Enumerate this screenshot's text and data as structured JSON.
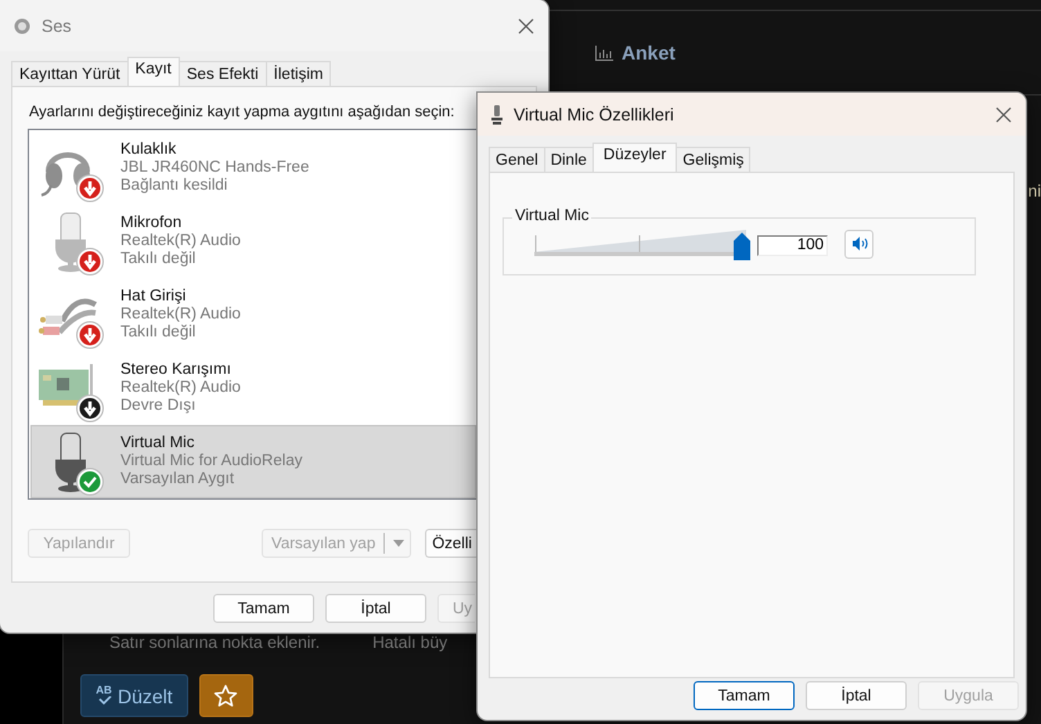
{
  "background_app": {
    "section_title": "Anket",
    "edge_text": "ni",
    "hints": [
      "Satır sonlarına nokta eklenir.",
      "Hatalı büy"
    ],
    "fix_button": {
      "icon_text": "AB",
      "label": "Düzelt"
    }
  },
  "sound_window": {
    "title": "Ses",
    "tabs": [
      {
        "label": "Kayıttan Yürüt",
        "selected": false
      },
      {
        "label": "Kayıt",
        "selected": true
      },
      {
        "label": "Ses Efekti",
        "selected": false
      },
      {
        "label": "İletişim",
        "selected": false
      }
    ],
    "instruction": "Ayarlarını değiştireceğiniz kayıt yapma aygıtını aşağıdan seçin:",
    "devices": [
      {
        "name": "Kulaklık",
        "driver": "JBL JR460NC Hands-Free",
        "status_text": "Bağlantı kesildi",
        "kind": "headset",
        "enabled": true,
        "default": false,
        "selected": false
      },
      {
        "name": "Mikrofon",
        "driver": "Realtek(R) Audio",
        "status_text": "Takılı değil",
        "kind": "microphone",
        "enabled": true,
        "default": false,
        "selected": false
      },
      {
        "name": "Hat Girişi",
        "driver": "Realtek(R) Audio",
        "status_text": "Takılı değil",
        "kind": "cable",
        "enabled": true,
        "default": false,
        "selected": false
      },
      {
        "name": "Stereo Karışımı",
        "driver": "Realtek(R) Audio",
        "status_text": "Devre Dışı",
        "kind": "card",
        "enabled": false,
        "default": false,
        "selected": false
      },
      {
        "name": "Virtual Mic",
        "driver": "Virtual Mic for AudioRelay",
        "status_text": "Varsayılan Aygıt",
        "kind": "microphone",
        "enabled": true,
        "default": true,
        "selected": true
      }
    ],
    "configure_button": {
      "label": "Yapılandır",
      "disabled": true
    },
    "set_default_button": {
      "label": "Varsayılan yap",
      "disabled": true
    },
    "properties_button": {
      "label": "Özelli",
      "disabled": false
    },
    "buttons": [
      {
        "label": "Tamam",
        "disabled": false
      },
      {
        "label": "İptal",
        "disabled": false
      },
      {
        "label": "Uy",
        "disabled": true
      }
    ]
  },
  "properties_window": {
    "title": "Virtual Mic Özellikleri",
    "tabs": [
      {
        "label": "Genel",
        "selected": false
      },
      {
        "label": "Dinle",
        "selected": false
      },
      {
        "label": "Düzeyler",
        "selected": true
      },
      {
        "label": "Gelişmiş",
        "selected": false
      }
    ],
    "group_label": "Virtual Mic",
    "level": 1,
    "value": "100",
    "buttons": [
      {
        "label": "Tamam",
        "default": true,
        "disabled": false
      },
      {
        "label": "İptal",
        "default": false,
        "disabled": false
      },
      {
        "label": "Uygula",
        "default": false,
        "disabled": true
      }
    ]
  }
}
